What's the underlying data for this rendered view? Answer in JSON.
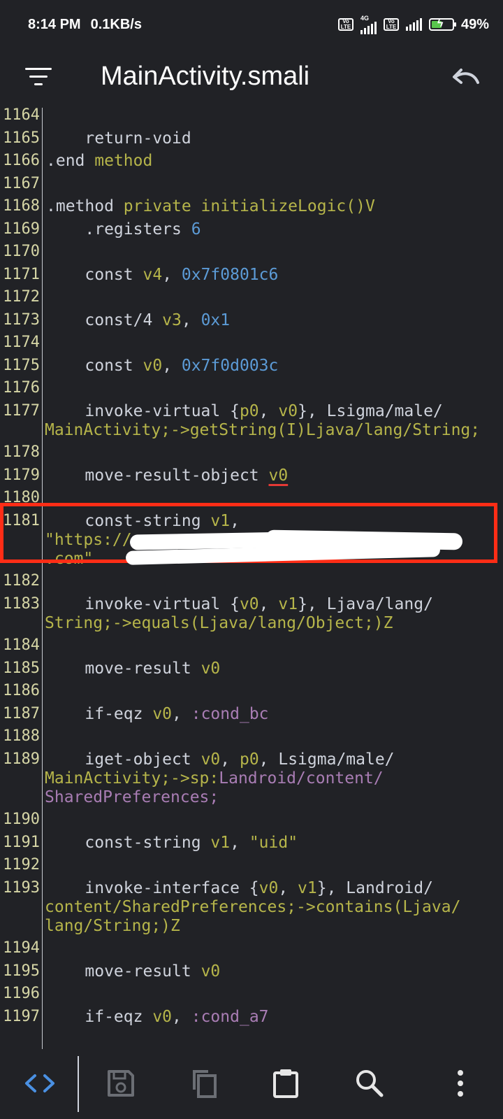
{
  "status_bar": {
    "time": "8:14 PM",
    "net_speed": "0.1KB/s",
    "sim1_tag": "Vo LTE",
    "sim1_network": "4G",
    "sim2_tag": "Vo LTE",
    "battery": "49%",
    "battery_level": 0.49,
    "colors": {
      "battery_fill": "#59c64d"
    }
  },
  "app_bar": {
    "title": "MainActivity.smali",
    "menu_icon": "filter-menu-icon",
    "undo_icon": "undo-icon"
  },
  "editor": {
    "colors": {
      "background": "#212226",
      "keyword": "#cfd3dc",
      "register": "#b6b54a",
      "number": "#5c9bd6",
      "label": "#a97db4",
      "line_number": "#d6d6a6",
      "highlight_border": "#ff2d16"
    },
    "lines": [
      {
        "n": "1164",
        "code": ""
      },
      {
        "n": "1165",
        "code": "    return-void"
      },
      {
        "n": "1166",
        "code": ".end method"
      },
      {
        "n": "1167",
        "code": ""
      },
      {
        "n": "1168",
        "code": ".method private initializeLogic()V"
      },
      {
        "n": "1169",
        "code": "    .registers 6"
      },
      {
        "n": "1170",
        "code": ""
      },
      {
        "n": "1171",
        "code": "    const v4, 0x7f0801c6"
      },
      {
        "n": "1172",
        "code": ""
      },
      {
        "n": "1173",
        "code": "    const/4 v3, 0x1"
      },
      {
        "n": "1174",
        "code": ""
      },
      {
        "n": "1175",
        "code": "    const v0, 0x7f0d003c"
      },
      {
        "n": "1176",
        "code": ""
      },
      {
        "n": "1177",
        "code": "    invoke-virtual {p0, v0}, Lsigma/male/",
        "wrap": "MainActivity;->getString(I)Ljava/lang/String;"
      },
      {
        "n": "1178",
        "code": ""
      },
      {
        "n": "1179",
        "code": "    move-result-object v0"
      },
      {
        "n": "1180",
        "code": ""
      },
      {
        "n": "1181",
        "code": "    const-string v1,",
        "wrap": "\"https://",
        "wrap2": ".com\""
      },
      {
        "n": "1182",
        "code": ""
      },
      {
        "n": "1183",
        "code": "    invoke-virtual {v0, v1}, Ljava/lang/",
        "wrap": "String;->equals(Ljava/lang/Object;)Z"
      },
      {
        "n": "1184",
        "code": ""
      },
      {
        "n": "1185",
        "code": "    move-result v0"
      },
      {
        "n": "1186",
        "code": ""
      },
      {
        "n": "1187",
        "code": "    if-eqz v0, :cond_bc"
      },
      {
        "n": "1188",
        "code": ""
      },
      {
        "n": "1189",
        "code": "    iget-object v0, p0, Lsigma/male/",
        "wrap": "MainActivity;->sp:Landroid/content/",
        "wrap2": "SharedPreferences;"
      },
      {
        "n": "1190",
        "code": ""
      },
      {
        "n": "1191",
        "code": "    const-string v1, \"uid\""
      },
      {
        "n": "1192",
        "code": ""
      },
      {
        "n": "1193",
        "code": "    invoke-interface {v0, v1}, Landroid/",
        "wrap": "content/SharedPreferences;->contains(Ljava/",
        "wrap2": "lang/String;)Z"
      },
      {
        "n": "1194",
        "code": ""
      },
      {
        "n": "1195",
        "code": "    move-result v0"
      },
      {
        "n": "1196",
        "code": ""
      },
      {
        "n": "1197",
        "code": "    if-eqz v0, :cond_a7"
      }
    ]
  },
  "bottom_bar": {
    "items": [
      {
        "icon": "code-icon"
      },
      {
        "icon": "save-icon"
      },
      {
        "icon": "copy-icon"
      },
      {
        "icon": "clipboard-icon"
      },
      {
        "icon": "search-icon"
      },
      {
        "icon": "more-vert-icon"
      }
    ]
  }
}
